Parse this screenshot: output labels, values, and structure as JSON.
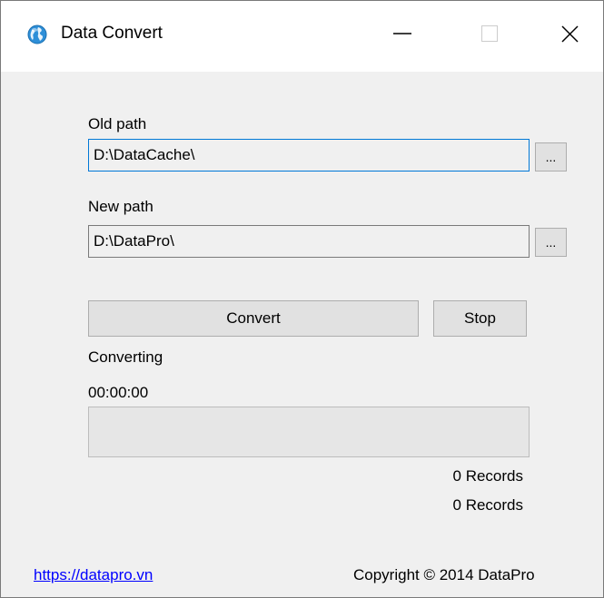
{
  "window": {
    "title": "Data Convert",
    "icon": "globe-icon"
  },
  "titlebar_buttons": {
    "minimize_icon": "minimize-icon",
    "maximize_icon": "maximize-icon",
    "close_icon": "close-icon"
  },
  "old_path": {
    "label": "Old path",
    "value": "D:\\DataCache\\",
    "browse_label": "..."
  },
  "new_path": {
    "label": "New path",
    "value": "D:\\DataPro\\",
    "browse_label": "..."
  },
  "actions": {
    "convert_label": "Convert",
    "stop_label": "Stop"
  },
  "status": {
    "state_text": "Converting",
    "elapsed_time": "00:00:00",
    "progress_percent": 0,
    "records_1": "0 Records",
    "records_2": "0 Records"
  },
  "footer": {
    "link_text": "https://datapro.vn",
    "copyright_text": "Copyright © 2014 DataPro"
  },
  "colors": {
    "window_bg": "#f0f0f0",
    "focus_border": "#0078d7",
    "link": "#0000ff",
    "progress_fill": "#06b025"
  }
}
